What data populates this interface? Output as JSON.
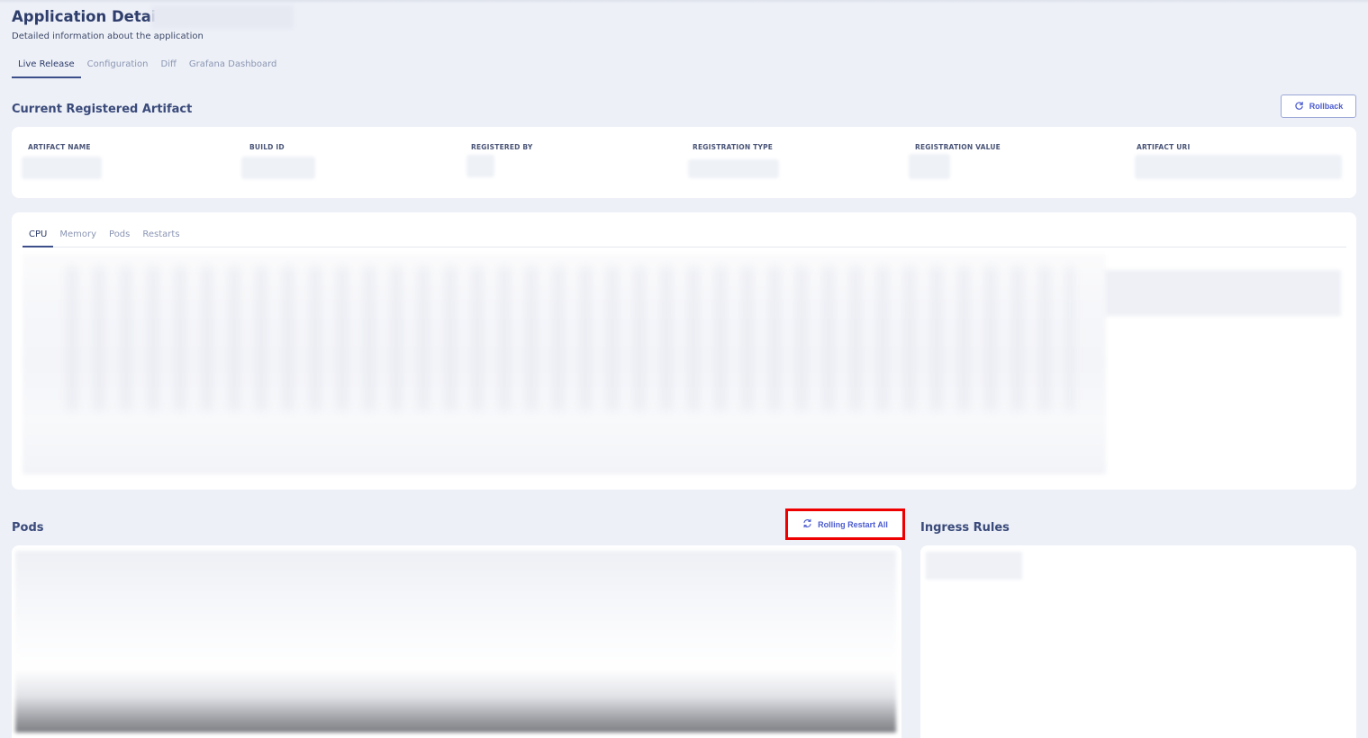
{
  "header": {
    "title": "Application Details:",
    "subtitle": "Detailed information about the application"
  },
  "tabs": [
    {
      "label": "Live Release",
      "active": true
    },
    {
      "label": "Configuration",
      "active": false
    },
    {
      "label": "Diff",
      "active": false
    },
    {
      "label": "Grafana Dashboard",
      "active": false
    }
  ],
  "artifact": {
    "section_title": "Current Registered Artifact",
    "rollback_label": "Rollback",
    "columns": [
      "ARTIFACT NAME",
      "BUILD ID",
      "REGISTERED BY",
      "REGISTRATION TYPE",
      "REGISTRATION VALUE",
      "ARTIFACT URI"
    ]
  },
  "metrics": {
    "tabs": [
      {
        "label": "CPU",
        "active": true
      },
      {
        "label": "Memory",
        "active": false
      },
      {
        "label": "Pods",
        "active": false
      },
      {
        "label": "Restarts",
        "active": false
      }
    ]
  },
  "pods": {
    "section_title": "Pods",
    "restart_label": "Rolling Restart All"
  },
  "ingress": {
    "section_title": "Ingress Rules"
  },
  "colors": {
    "background": "#edf0f7",
    "accent": "#4b5bd0",
    "highlight": "#ee0000"
  }
}
